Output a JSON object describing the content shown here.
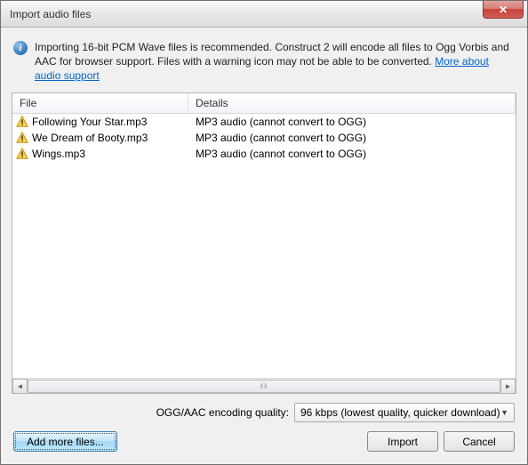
{
  "window": {
    "title": "Import audio files"
  },
  "info": {
    "text_1": "Importing 16-bit PCM Wave files is recommended.  Construct 2 will encode all files to Ogg Vorbis and AAC for browser support.  Files with a warning icon may not be able to be converted.  ",
    "link": "More about audio support"
  },
  "columns": {
    "file": "File",
    "details": "Details"
  },
  "files": [
    {
      "name": "Following Your Star.mp3",
      "details": "MP3 audio (cannot convert to OGG)"
    },
    {
      "name": "We Dream of Booty.mp3",
      "details": "MP3 audio (cannot convert to OGG)"
    },
    {
      "name": "Wings.mp3",
      "details": "MP3 audio (cannot convert to OGG)"
    }
  ],
  "quality": {
    "label": "OGG/AAC encoding quality:",
    "selected": "96 kbps (lowest quality, quicker download)"
  },
  "buttons": {
    "add": "Add more files...",
    "import": "Import",
    "cancel": "Cancel"
  }
}
